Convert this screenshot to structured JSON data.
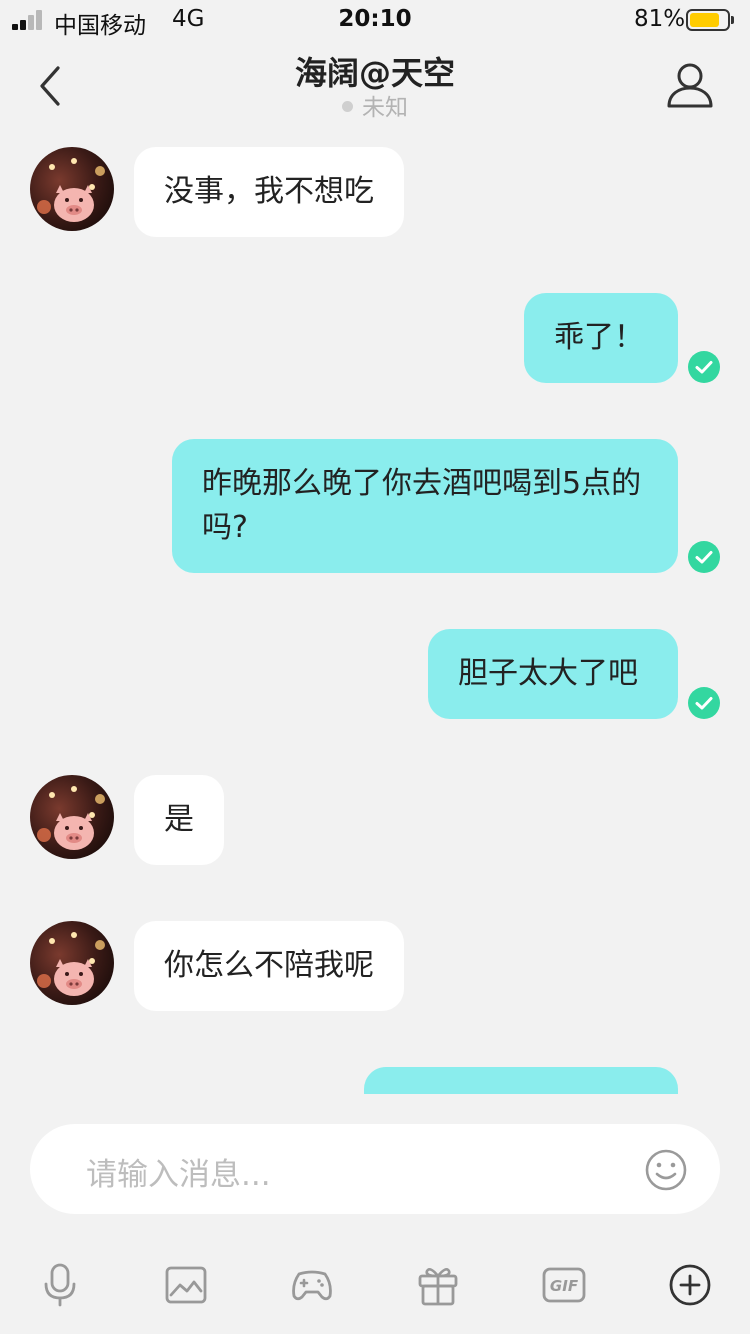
{
  "status_bar": {
    "carrier": "中国移动",
    "network": "4G",
    "time": "20:10",
    "battery": "81%",
    "battery_level": 0.81,
    "battery_color": "#ffcc00"
  },
  "header": {
    "back_icon": "chevron-left-icon",
    "title": "海阔@天空",
    "subtitle": "未知",
    "profile_icon": "person-icon"
  },
  "chat": {
    "incoming_color": "#ffffff",
    "outgoing_color": "#8aeded",
    "check_color": "#33d7a0",
    "messages": [
      {
        "from": "them",
        "text": "没事，我不想吃"
      },
      {
        "from": "me",
        "text": "乖了！",
        "delivered": true
      },
      {
        "from": "me",
        "text": "昨晚那么晚了你去酒吧喝到5点的吗?",
        "delivered": true
      },
      {
        "from": "me",
        "text": "胆子太大了吧",
        "delivered": true
      },
      {
        "from": "them",
        "text": "是"
      },
      {
        "from": "them",
        "text": "你怎么不陪我呢"
      },
      {
        "from": "me",
        "text": ""
      }
    ]
  },
  "composer": {
    "placeholder": "请输入消息...",
    "emoji_icon": "smiley-icon"
  },
  "toolbar": {
    "items": [
      "microphone-icon",
      "image-icon",
      "gamepad-icon",
      "gift-icon",
      "gif-icon",
      "plus-circle-icon"
    ],
    "gif_label": "GIF"
  }
}
